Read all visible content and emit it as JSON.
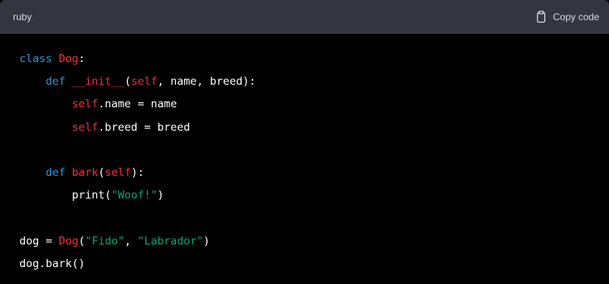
{
  "header": {
    "language": "ruby",
    "copy_label": "Copy code",
    "copy_icon": "clipboard-icon"
  },
  "colors": {
    "header_bg": "#343541",
    "code_bg": "#000000",
    "keyword": "#2e95d3",
    "class_name": "#f22c3d",
    "string": "#00a67d",
    "plain": "#ffffff"
  },
  "code": {
    "lines": [
      [
        {
          "t": "class",
          "c": "kw"
        },
        {
          "t": " "
        },
        {
          "t": "Dog",
          "c": "cls"
        },
        {
          "t": ":"
        }
      ],
      [
        {
          "t": "    "
        },
        {
          "t": "def",
          "c": "kw"
        },
        {
          "t": " "
        },
        {
          "t": "__init__",
          "c": "cls"
        },
        {
          "t": "("
        },
        {
          "t": "self",
          "c": "cls"
        },
        {
          "t": ", name, breed):"
        }
      ],
      [
        {
          "t": "        "
        },
        {
          "t": "self",
          "c": "cls"
        },
        {
          "t": ".name = name"
        }
      ],
      [
        {
          "t": "        "
        },
        {
          "t": "self",
          "c": "cls"
        },
        {
          "t": ".breed = breed"
        }
      ],
      [],
      [
        {
          "t": "    "
        },
        {
          "t": "def",
          "c": "kw"
        },
        {
          "t": " "
        },
        {
          "t": "bark",
          "c": "cls"
        },
        {
          "t": "("
        },
        {
          "t": "self",
          "c": "cls"
        },
        {
          "t": "):"
        }
      ],
      [
        {
          "t": "        print("
        },
        {
          "t": "\"Woof!\"",
          "c": "str"
        },
        {
          "t": ")"
        }
      ],
      [],
      [
        {
          "t": "dog = "
        },
        {
          "t": "Dog",
          "c": "cls"
        },
        {
          "t": "("
        },
        {
          "t": "\"Fido\"",
          "c": "str"
        },
        {
          "t": ", "
        },
        {
          "t": "\"Labrador\"",
          "c": "str"
        },
        {
          "t": ")"
        }
      ],
      [
        {
          "t": "dog.bark()"
        }
      ]
    ]
  }
}
